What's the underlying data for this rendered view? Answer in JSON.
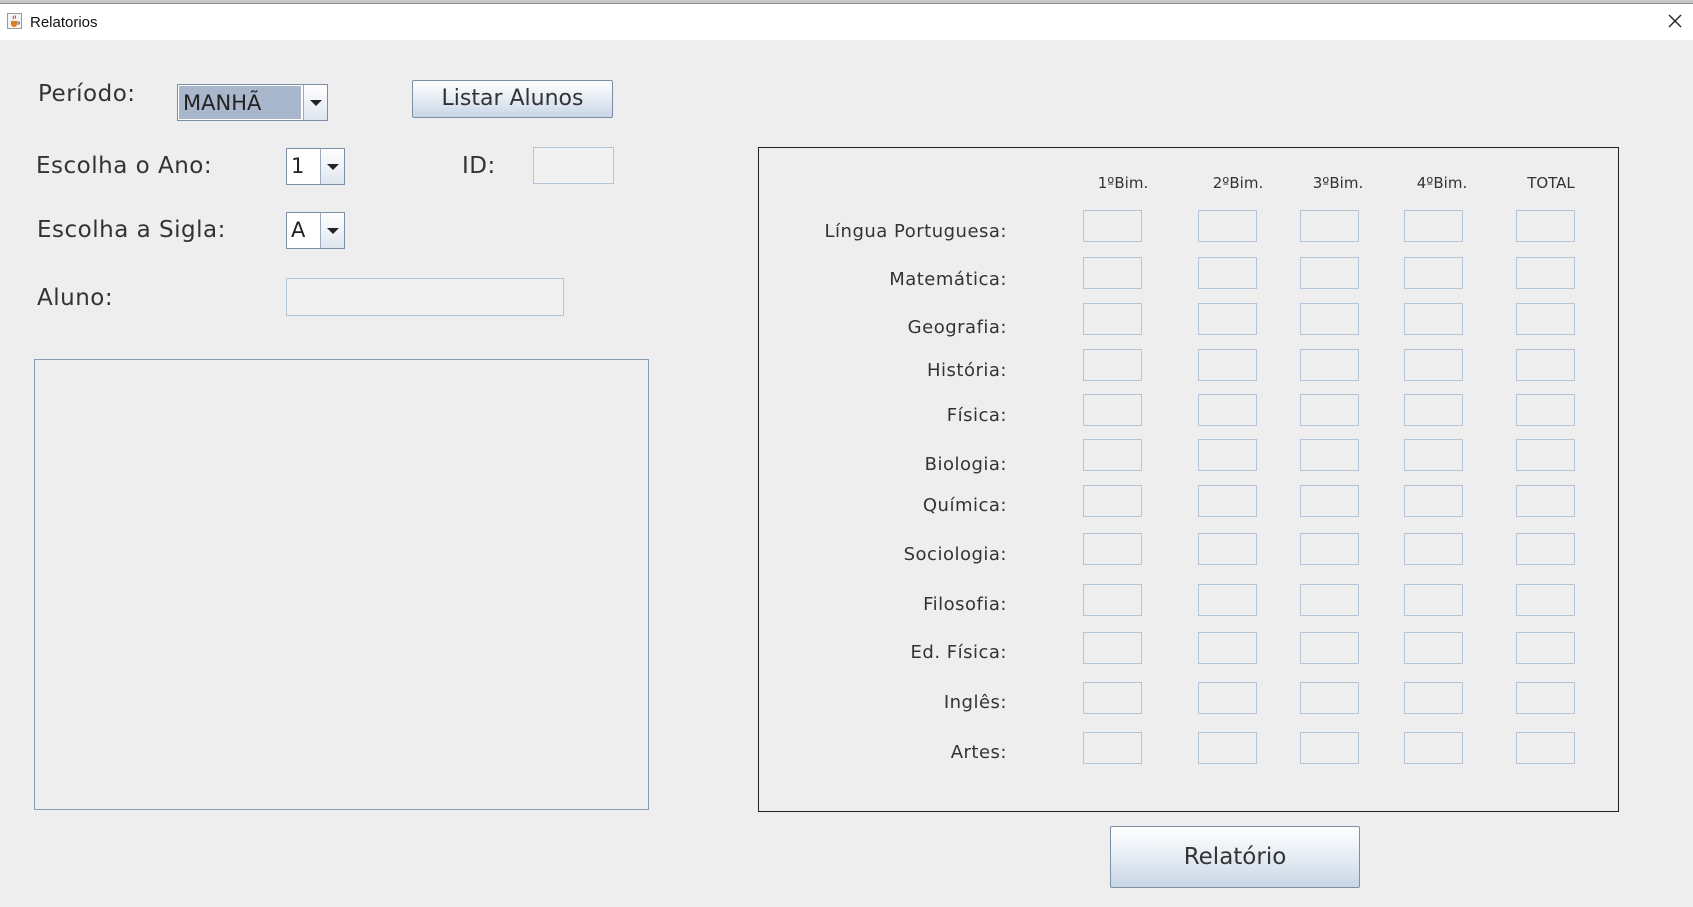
{
  "window": {
    "title": "Relatorios",
    "icon": "java-cup-icon",
    "close_icon": "close-icon"
  },
  "form": {
    "periodo_label": "Período:",
    "periodo_value": "MANHÃ",
    "listar_button": "Listar Alunos",
    "ano_label": "Escolha o Ano:",
    "ano_value": "1",
    "id_label": "ID:",
    "id_value": "",
    "sigla_label": "Escolha a Sigla:",
    "sigla_value": "A",
    "aluno_label": "Aluno:",
    "aluno_value": ""
  },
  "grades": {
    "columns": [
      "1ºBim.",
      "2ºBim.",
      "3ºBim.",
      "4ºBim.",
      "TOTAL"
    ],
    "subjects": [
      "Língua Portuguesa:",
      "Matemática:",
      "Geografia:",
      "História:",
      "Física:",
      "Biologia:",
      "Química:",
      "Sociologia:",
      "Filosofia:",
      "Ed. Física:",
      "Inglês:",
      "Artes:"
    ]
  },
  "relatorio_button": "Relatório",
  "colors": {
    "background": "#eeeeee",
    "titlebar": "#ffffff",
    "field_border": "#b5c4d6",
    "selected_combo": "#a8b7cc"
  }
}
